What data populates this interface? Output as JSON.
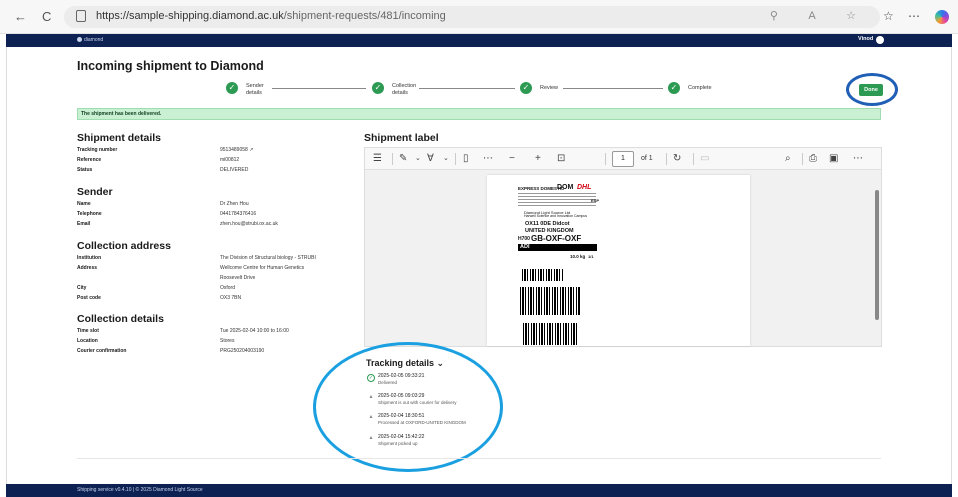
{
  "browser": {
    "url_main": "https://sample-shipping.diamond.ac.uk",
    "url_path": "/shipment-requests/481/incoming",
    "back": "←",
    "reload": "C",
    "addr_icons": "⚲ A ☆",
    "fav": "☆",
    "ext": "⋯"
  },
  "appbar": {
    "logo": "diamond",
    "user": "Vinod"
  },
  "page": {
    "title": "Incoming shipment to Diamond"
  },
  "steps": [
    {
      "label1": "Sender",
      "label2": "details"
    },
    {
      "label1": "Collection",
      "label2": "details"
    },
    {
      "label1": "Review",
      "label2": ""
    },
    {
      "label1": "Complete",
      "label2": ""
    }
  ],
  "done_label": "Done",
  "alert": "The shipment has been delivered.",
  "shipment_details": {
    "heading": "Shipment details",
    "rows": [
      {
        "k": "Tracking number",
        "v": "9513489058 ↗"
      },
      {
        "k": "Reference",
        "v": "mi00812"
      },
      {
        "k": "Status",
        "v": "DELIVERED"
      }
    ]
  },
  "sender": {
    "heading": "Sender",
    "rows": [
      {
        "k": "Name",
        "v": "Dr Zhen Hou"
      },
      {
        "k": "Telephone",
        "v": "0441784376416"
      },
      {
        "k": "Email",
        "v": "zhen.hou@strubi.ox.ac.uk"
      }
    ]
  },
  "collection_address": {
    "heading": "Collection address",
    "institution_k": "Institution",
    "institution_v": "The Division of Structural biology - STRUBI",
    "address_k": "Address",
    "address_v1": "Wellcome Centre for Human Genetics",
    "address_v2": "Roosevelt Drive",
    "city_k": "City",
    "city_v": "Oxford",
    "postcode_k": "Post code",
    "postcode_v": "OX3 7BN"
  },
  "collection_details": {
    "heading": "Collection details",
    "rows": [
      {
        "k": "Time slot",
        "v": "Tue 2025-02-04 10:00 to 16:00"
      },
      {
        "k": "Location",
        "v": "Stores"
      },
      {
        "k": "Courier confirmation",
        "v": "PRG250204003190"
      }
    ]
  },
  "shipment_label": {
    "heading": "Shipment label",
    "page": "1",
    "of": "of 1",
    "label": {
      "service": "EXPRESS DOMESTIC",
      "dom": "DOM",
      "dhl": "DHL",
      "code": "ESP",
      "to_line1": "Diamond Light Source Ltd",
      "to_line2": "Harwell Science and Innovation Campus",
      "to_city": "OX11 0DE Didcot",
      "country": "UNITED KINGDOM",
      "route": "GB-OXF-OXF",
      "route_prefix": "H700",
      "adi": "ADI",
      "weight": "10.0 kg",
      "piece": "1/1"
    }
  },
  "tracking": {
    "title": "Tracking details",
    "caret": "⌄",
    "events": [
      {
        "time": "2025-02-05 09:33:21",
        "desc": "Delivered",
        "icon": "check-circle-icon"
      },
      {
        "time": "2025-02-05 09:03:29",
        "desc": "Shipment is out with courier for delivery",
        "icon": "caret-up-icon"
      },
      {
        "time": "2025-02-04 18:30:51",
        "desc": "Processed at OXFORD-UNITED KINGDOM",
        "icon": "caret-up-icon"
      },
      {
        "time": "2025-02-04 15:42:22",
        "desc": "Shipment picked up",
        "icon": "caret-up-icon"
      }
    ]
  },
  "footer": "Shipping service v0.4.10 | © 2025 Diamond Light Source",
  "colors": {
    "navy": "#0d2253",
    "green": "#2c9a52",
    "alert_bg": "#c9f0d2",
    "ring_blue": "#1f5fb5",
    "ring_cyan": "#1aa0e0"
  }
}
